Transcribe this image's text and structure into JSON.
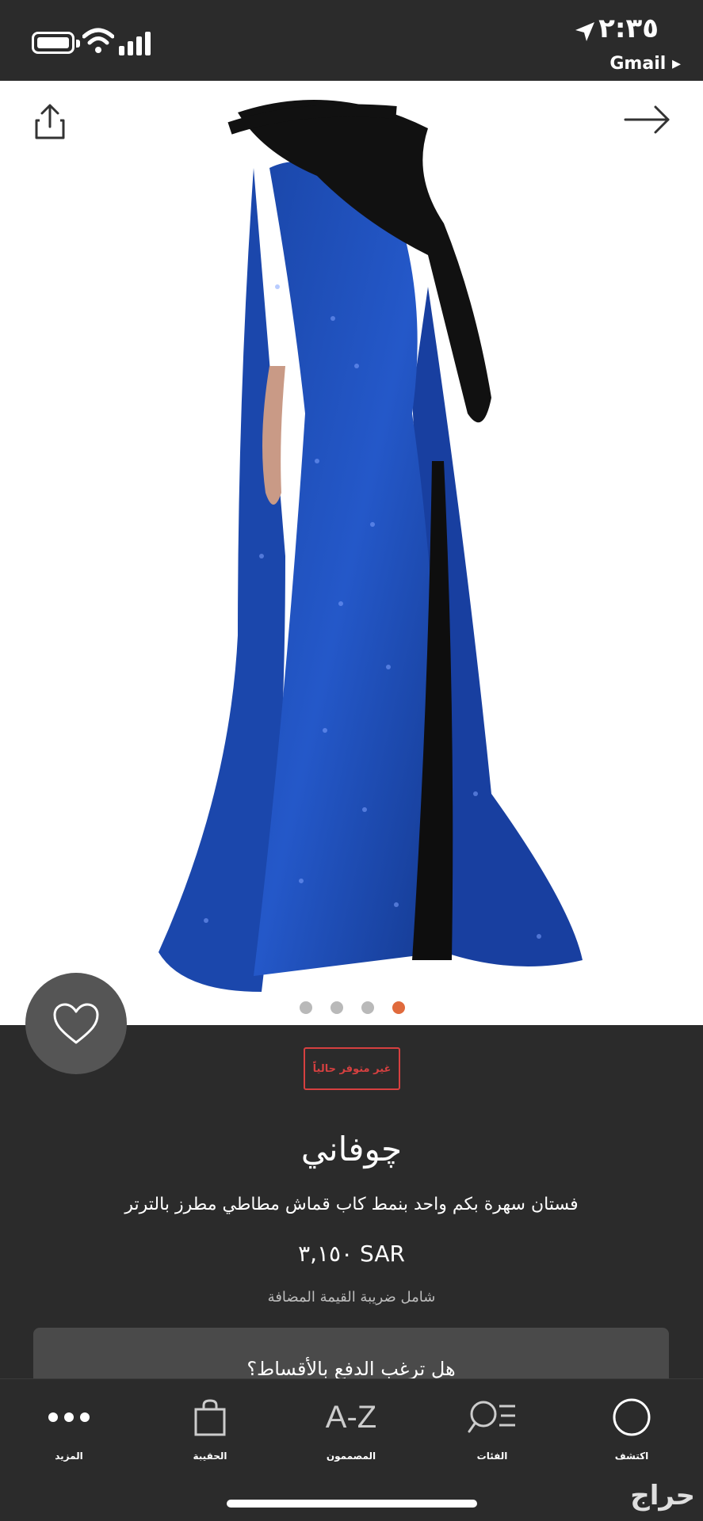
{
  "status_bar": {
    "time": "٢:٣٥",
    "back_app": "Gmail ▸"
  },
  "product": {
    "availability_badge": "غير متوفر حالياً",
    "brand": "چوفاني",
    "description": "فستان سهرة بكم واحد بنمط كاب قماش مطاطي مطرز بالترتر",
    "price": "٣,١٥٠ SAR",
    "vat_note": "شامل ضريبة القيمة المضافة",
    "installments_prompt": "هل ترغب الدفع بالأقساط؟",
    "image_count": 4,
    "active_image_index": 3,
    "dress_color": "#1d4fb8"
  },
  "bottom_nav": {
    "items": [
      {
        "label": "المزيد",
        "icon": "more-dots-icon"
      },
      {
        "label": "الحقيبة",
        "icon": "bag-icon"
      },
      {
        "label": "المصممون",
        "icon": "a-z-icon",
        "glyph": "A-Z"
      },
      {
        "label": "الفئات",
        "icon": "categories-search-icon"
      },
      {
        "label": "اكتشف",
        "icon": "discover-circle-icon"
      }
    ]
  },
  "watermark": "حراج",
  "colors": {
    "background": "#2b2b2b",
    "accent_dot": "#e06a3c",
    "badge_red": "#d64040"
  }
}
